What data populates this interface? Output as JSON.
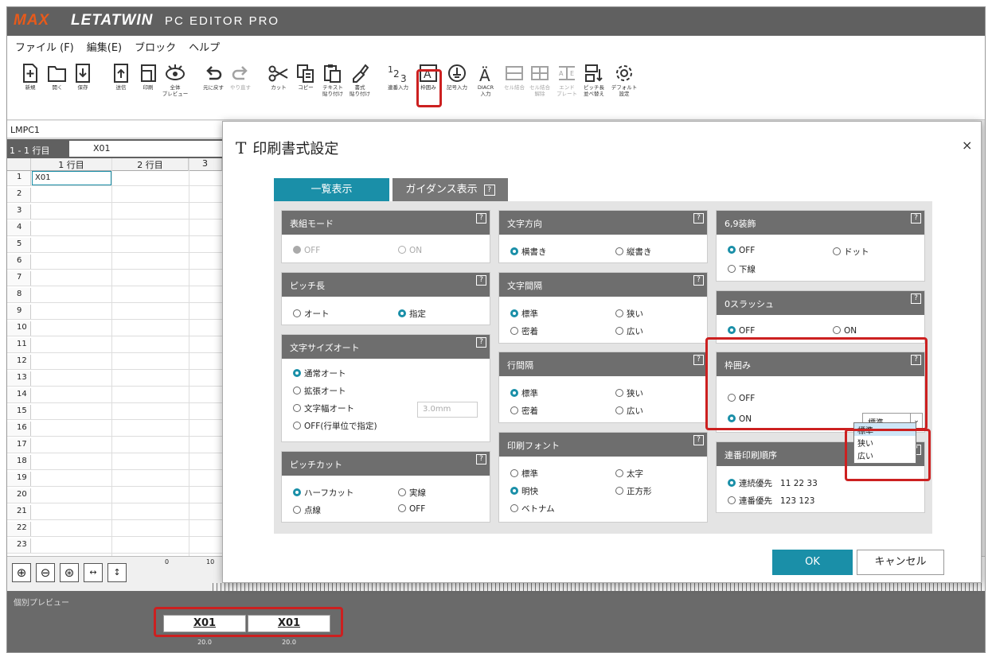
{
  "titlebar": {
    "brand": "MAX",
    "product": "LETATWIN",
    "edition": "PC EDITOR PRO"
  },
  "menu": [
    "ファイル (F)",
    "編集(E)",
    "ブロック",
    "ヘルプ"
  ],
  "toolbar": [
    {
      "icon": "new-icon",
      "label": "新規"
    },
    {
      "icon": "open-icon",
      "label": "開く"
    },
    {
      "icon": "save-icon",
      "label": "保存"
    },
    {
      "icon": "send-icon",
      "label": "送信"
    },
    {
      "icon": "print-icon",
      "label": "印刷"
    },
    {
      "icon": "preview-icon",
      "label": "全体\nプレビュー"
    },
    {
      "icon": "undo-icon",
      "label": "元に戻す"
    },
    {
      "icon": "redo-icon",
      "label": "やり直す"
    },
    {
      "icon": "cut-icon",
      "label": "カット"
    },
    {
      "icon": "copy-icon",
      "label": "コピー"
    },
    {
      "icon": "paste-text-icon",
      "label": "テキスト\n貼り付け"
    },
    {
      "icon": "paste-format-icon",
      "label": "書式\n貼り付け"
    },
    {
      "icon": "serial-input-icon",
      "label": "連番入力"
    },
    {
      "icon": "frame-icon",
      "label": "枠囲み"
    },
    {
      "icon": "symbol-input-icon",
      "label": "記号入力"
    },
    {
      "icon": "diacritic-icon",
      "label": "DIACR\n入力"
    },
    {
      "icon": "cell-merge-icon",
      "label": "セル結合"
    },
    {
      "icon": "cell-unmerge-icon",
      "label": "セル結合\n解除"
    },
    {
      "icon": "end-plate-icon",
      "label": "エンド\nプレート"
    },
    {
      "icon": "pitch-sort-icon",
      "label": "ピッチ長\n並べ替え"
    },
    {
      "icon": "default-settings-icon",
      "label": "デフォルト\n設定"
    }
  ],
  "editor": {
    "doc_name": "LMPC1",
    "row_label": "1 - 1 行目",
    "row_value": "X01",
    "col_headers": [
      "1 行目",
      "2 行目",
      "3"
    ],
    "rows": [
      "1",
      "2",
      "3",
      "4",
      "5",
      "6",
      "7",
      "8",
      "9",
      "10",
      "11",
      "12",
      "13",
      "14",
      "15",
      "16",
      "17",
      "18",
      "19",
      "20",
      "21",
      "22",
      "23"
    ],
    "cell_1_1": "X01"
  },
  "zoom": {
    "ruler_0": "0",
    "ruler_10": "10"
  },
  "preview": {
    "label": "個別プレビュー",
    "tags": [
      "X01",
      "X01"
    ],
    "dims": [
      "20.0",
      "20.0"
    ]
  },
  "dialog": {
    "title": "印刷書式設定",
    "close": "×",
    "tabs": {
      "active": "一覧表示",
      "other": "ガイダンス表示"
    },
    "help": "?",
    "panels": {
      "table_mode": {
        "title": "表組モード",
        "options": [
          "OFF",
          "ON"
        ]
      },
      "pitch_length": {
        "title": "ピッチ長",
        "options": [
          "オート",
          "指定"
        ]
      },
      "auto_size": {
        "title": "文字サイズオート",
        "options": [
          "通常オート",
          "拡張オート",
          "文字幅オート",
          "OFF(行単位で指定)"
        ],
        "size_value": "3.0mm"
      },
      "pitch_cut": {
        "title": "ピッチカット",
        "options": [
          "ハーフカット",
          "実線",
          "点線",
          "OFF"
        ]
      },
      "direction": {
        "title": "文字方向",
        "options": [
          "横書き",
          "縦書き"
        ]
      },
      "char_spacing": {
        "title": "文字間隔",
        "options": [
          "標準",
          "狭い",
          "密着",
          "広い"
        ]
      },
      "line_spacing": {
        "title": "行間隔",
        "options": [
          "標準",
          "狭い",
          "密着",
          "広い"
        ]
      },
      "print_font": {
        "title": "印刷フォント",
        "options": [
          "標準",
          "太字",
          "明快",
          "正方形",
          "ベトナム"
        ]
      },
      "decoration_69": {
        "title": "6,9装飾",
        "options": [
          "OFF",
          "ドット",
          "下線"
        ]
      },
      "zero_slash": {
        "title": "0スラッシュ",
        "options": [
          "OFF",
          "ON"
        ]
      },
      "frame": {
        "title": "枠囲み",
        "options": [
          "OFF",
          "ON"
        ],
        "select_value": "標準"
      },
      "serial_order": {
        "title": "連番印刷順序",
        "options": [
          "連続優先",
          "連番優先"
        ],
        "examples": [
          "11 22 33",
          "123 123"
        ]
      }
    },
    "frame_dropdown": [
      "標準",
      "狭い",
      "広い"
    ],
    "ok": "OK",
    "cancel": "キャンセル"
  },
  "colors": {
    "accent": "#1a8fa8",
    "header_gray": "#6e6e6e",
    "highlight_red": "#cc2020"
  }
}
